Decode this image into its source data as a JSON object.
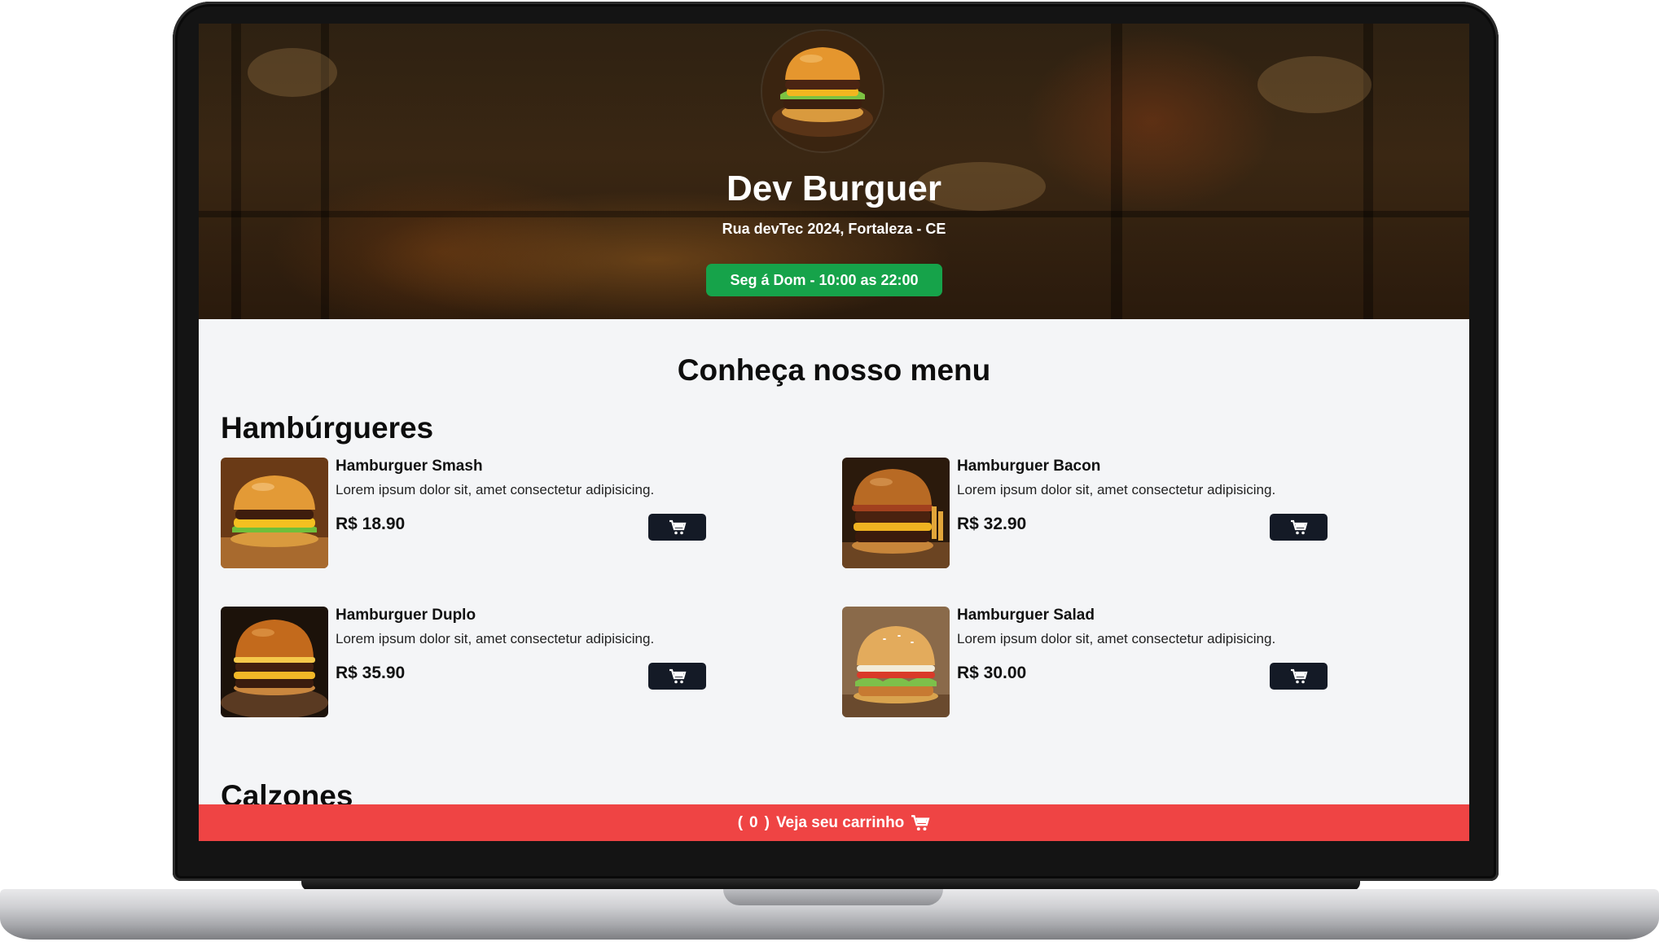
{
  "header": {
    "restaurant_name": "Dev Burguer",
    "address": "Rua devTec 2024, Fortaleza - CE",
    "hours": "Seg á Dom - 10:00 as 22:00"
  },
  "menu": {
    "title": "Conheça nosso menu",
    "sections": [
      {
        "title": "Hambúrgueres",
        "items": [
          {
            "name": "Hamburguer Smash",
            "description": "Lorem ipsum dolor sit, amet consectetur adipisicing.",
            "price": "R$ 18.90"
          },
          {
            "name": "Hamburguer Bacon",
            "description": "Lorem ipsum dolor sit, amet consectetur adipisicing.",
            "price": "R$ 32.90"
          },
          {
            "name": "Hamburguer Duplo",
            "description": "Lorem ipsum dolor sit, amet consectetur adipisicing.",
            "price": "R$ 35.90"
          },
          {
            "name": "Hamburguer Salad",
            "description": "Lorem ipsum dolor sit, amet consectetur adipisicing.",
            "price": "R$ 30.00"
          }
        ]
      },
      {
        "title": "Calzones",
        "items": []
      }
    ]
  },
  "cart": {
    "count_open": "(",
    "count": "0",
    "count_close": ")",
    "label": "Veja seu carrinho"
  },
  "icons": {
    "cart": "cart-icon"
  },
  "colors": {
    "badge_green": "#16a34a",
    "cart_bar_red": "#ef4444",
    "cart_button_dark": "#141a26",
    "page_background": "#f4f5f7"
  }
}
